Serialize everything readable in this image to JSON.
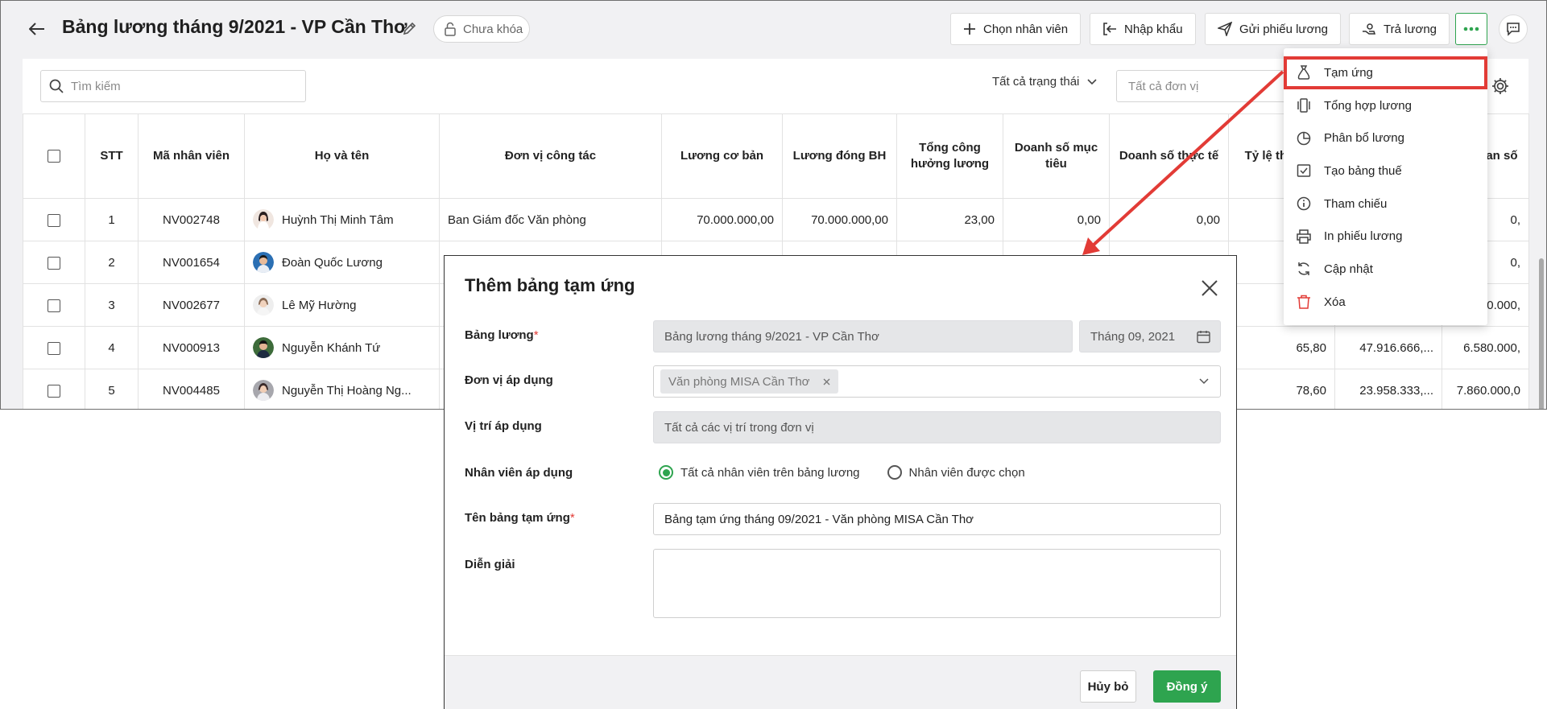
{
  "header": {
    "title": "Bảng lương tháng 9/2021 - VP Cần Thơ",
    "lock_status": "Chưa khóa",
    "buttons": {
      "select_employee": "Chọn nhân viên",
      "import": "Nhập khẩu",
      "send_payslip": "Gửi phiếu lương",
      "pay_salary": "Trả lương"
    }
  },
  "toolbar": {
    "search_placeholder": "Tìm kiếm",
    "status_filter": "Tất cả trạng thái",
    "unit_filter_placeholder": "Tất cả đơn vị"
  },
  "table": {
    "columns": [
      "STT",
      "Mã nhân viên",
      "Họ và tên",
      "Đơn vị công tác",
      "Lương cơ bản",
      "Lương đóng BH",
      "Tổng công hưởng lương",
      "Doanh số mục tiêu",
      "Doanh số thực tế",
      "Tỷ lệ thành s",
      "",
      "ng doan số"
    ],
    "rows": [
      {
        "stt": "1",
        "code": "NV002748",
        "name": "Huỳnh Thị Minh Tâm",
        "unit": "Ban Giám đốc Văn phòng",
        "base": "70.000.000,00",
        "insurance": "70.000.000,00",
        "workdays": "23,00",
        "target": "0,00",
        "actual": "0,00",
        "rate": "",
        "c11": "",
        "c12": "0,"
      },
      {
        "stt": "2",
        "code": "NV001654",
        "name": "Đoàn Quốc Lương",
        "unit": "",
        "base": "",
        "insurance": "",
        "workdays": "",
        "target": "",
        "actual": "",
        "rate": "",
        "c11": "",
        "c12": "0,"
      },
      {
        "stt": "3",
        "code": "NV002677",
        "name": "Lê Mỹ Hường",
        "unit": "",
        "base": "",
        "insurance": "",
        "workdays": "",
        "target": "",
        "actual": "",
        "rate": "",
        "c11": "",
        "c12": "0.000,"
      },
      {
        "stt": "4",
        "code": "NV000913",
        "name": "Nguyễn Khánh Tứ",
        "unit": "",
        "base": "",
        "insurance": "",
        "workdays": "",
        "target": "",
        "actual": "",
        "rate": "65,80",
        "c11": "47.916.666,...",
        "c12": "6.580.000,"
      },
      {
        "stt": "5",
        "code": "NV004485",
        "name": "Nguyễn Thị Hoàng Ng...",
        "unit": "",
        "base": "",
        "insurance": "",
        "workdays": "",
        "target": "",
        "actual": "",
        "rate": "78,60",
        "c11": "23.958.333,...",
        "c12": "7.860.000,0"
      }
    ]
  },
  "menu": {
    "items": [
      {
        "label": "Tạm ứng",
        "icon": "money-bag-icon"
      },
      {
        "label": "Tổng hợp lương",
        "icon": "summary-icon"
      },
      {
        "label": "Phân bổ lương",
        "icon": "pie-chart-icon"
      },
      {
        "label": "Tạo bảng thuế",
        "icon": "tax-table-icon"
      },
      {
        "label": "Tham chiếu",
        "icon": "info-icon"
      },
      {
        "label": "In phiếu lương",
        "icon": "printer-icon"
      },
      {
        "label": "Cập nhật",
        "icon": "refresh-icon"
      },
      {
        "label": "Xóa",
        "icon": "trash-icon"
      }
    ]
  },
  "dialog": {
    "title": "Thêm bảng tạm ứng",
    "fields": {
      "payroll_label": "Bảng lương",
      "payroll_value": "Bảng lương tháng 9/2021 - VP Cần Thơ",
      "month_value": "Tháng 09, 2021",
      "unit_label": "Đơn vị áp dụng",
      "unit_chip": "Văn phòng MISA Cần Thơ",
      "position_label": "Vị trí áp dụng",
      "position_value": "Tất cả các vị trí trong đơn vị",
      "employee_label": "Nhân viên áp dụng",
      "radio_all": "Tất cả nhân viên trên bảng lương",
      "radio_selected": "Nhân viên được chọn",
      "name_label": "Tên bảng tạm ứng",
      "name_value": "Bảng tạm ứng tháng 09/2021 - Văn phòng MISA Cần Thơ",
      "desc_label": "Diễn giải",
      "required_mark": "*"
    },
    "buttons": {
      "cancel": "Hủy bỏ",
      "ok": "Đồng ý"
    }
  },
  "colors": {
    "accent": "#2ea44f",
    "annotation": "#e23b36",
    "required": "#e23b36"
  }
}
